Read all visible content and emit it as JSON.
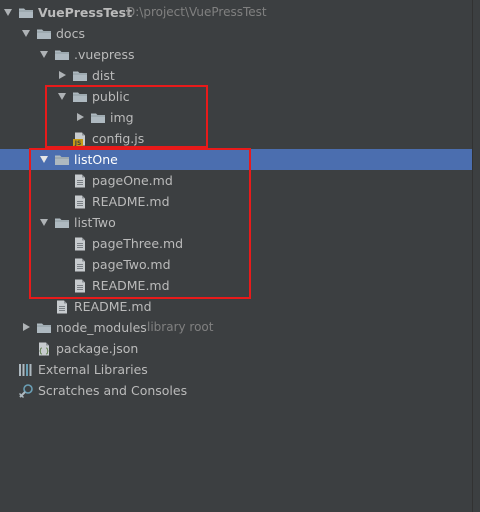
{
  "project_tree": {
    "root": {
      "name": "VuePressTest",
      "path": "D:\\project\\VuePressTest"
    },
    "docs": "docs",
    "vuepress": ".vuepress",
    "dist": "dist",
    "public": "public",
    "img": "img",
    "config": "config.js",
    "list_one": "listOne",
    "page_one": "pageOne.md",
    "readme_one": "README.md",
    "list_two": "listTwo",
    "page_three": "pageThree.md",
    "page_two": "pageTwo.md",
    "readme_two": "README.md",
    "readme_docs": "README.md",
    "node_modules": {
      "name": "node_modules",
      "hint": "library root"
    },
    "package_json": "package.json",
    "external_libraries": "External Libraries",
    "scratches": "Scratches and Consoles"
  },
  "colors": {
    "background": "#3c3f41",
    "selection": "#4b6eaf",
    "highlight_box": "#e81a1a",
    "folder_icon": "#aeb9c0",
    "js_badge": "#c59a16"
  },
  "icons": {
    "folder": "folder-icon",
    "file": "file-icon",
    "js": "js-file-icon",
    "json": "json-file-icon",
    "libraries": "libraries-icon",
    "scratches": "scratches-icon"
  }
}
